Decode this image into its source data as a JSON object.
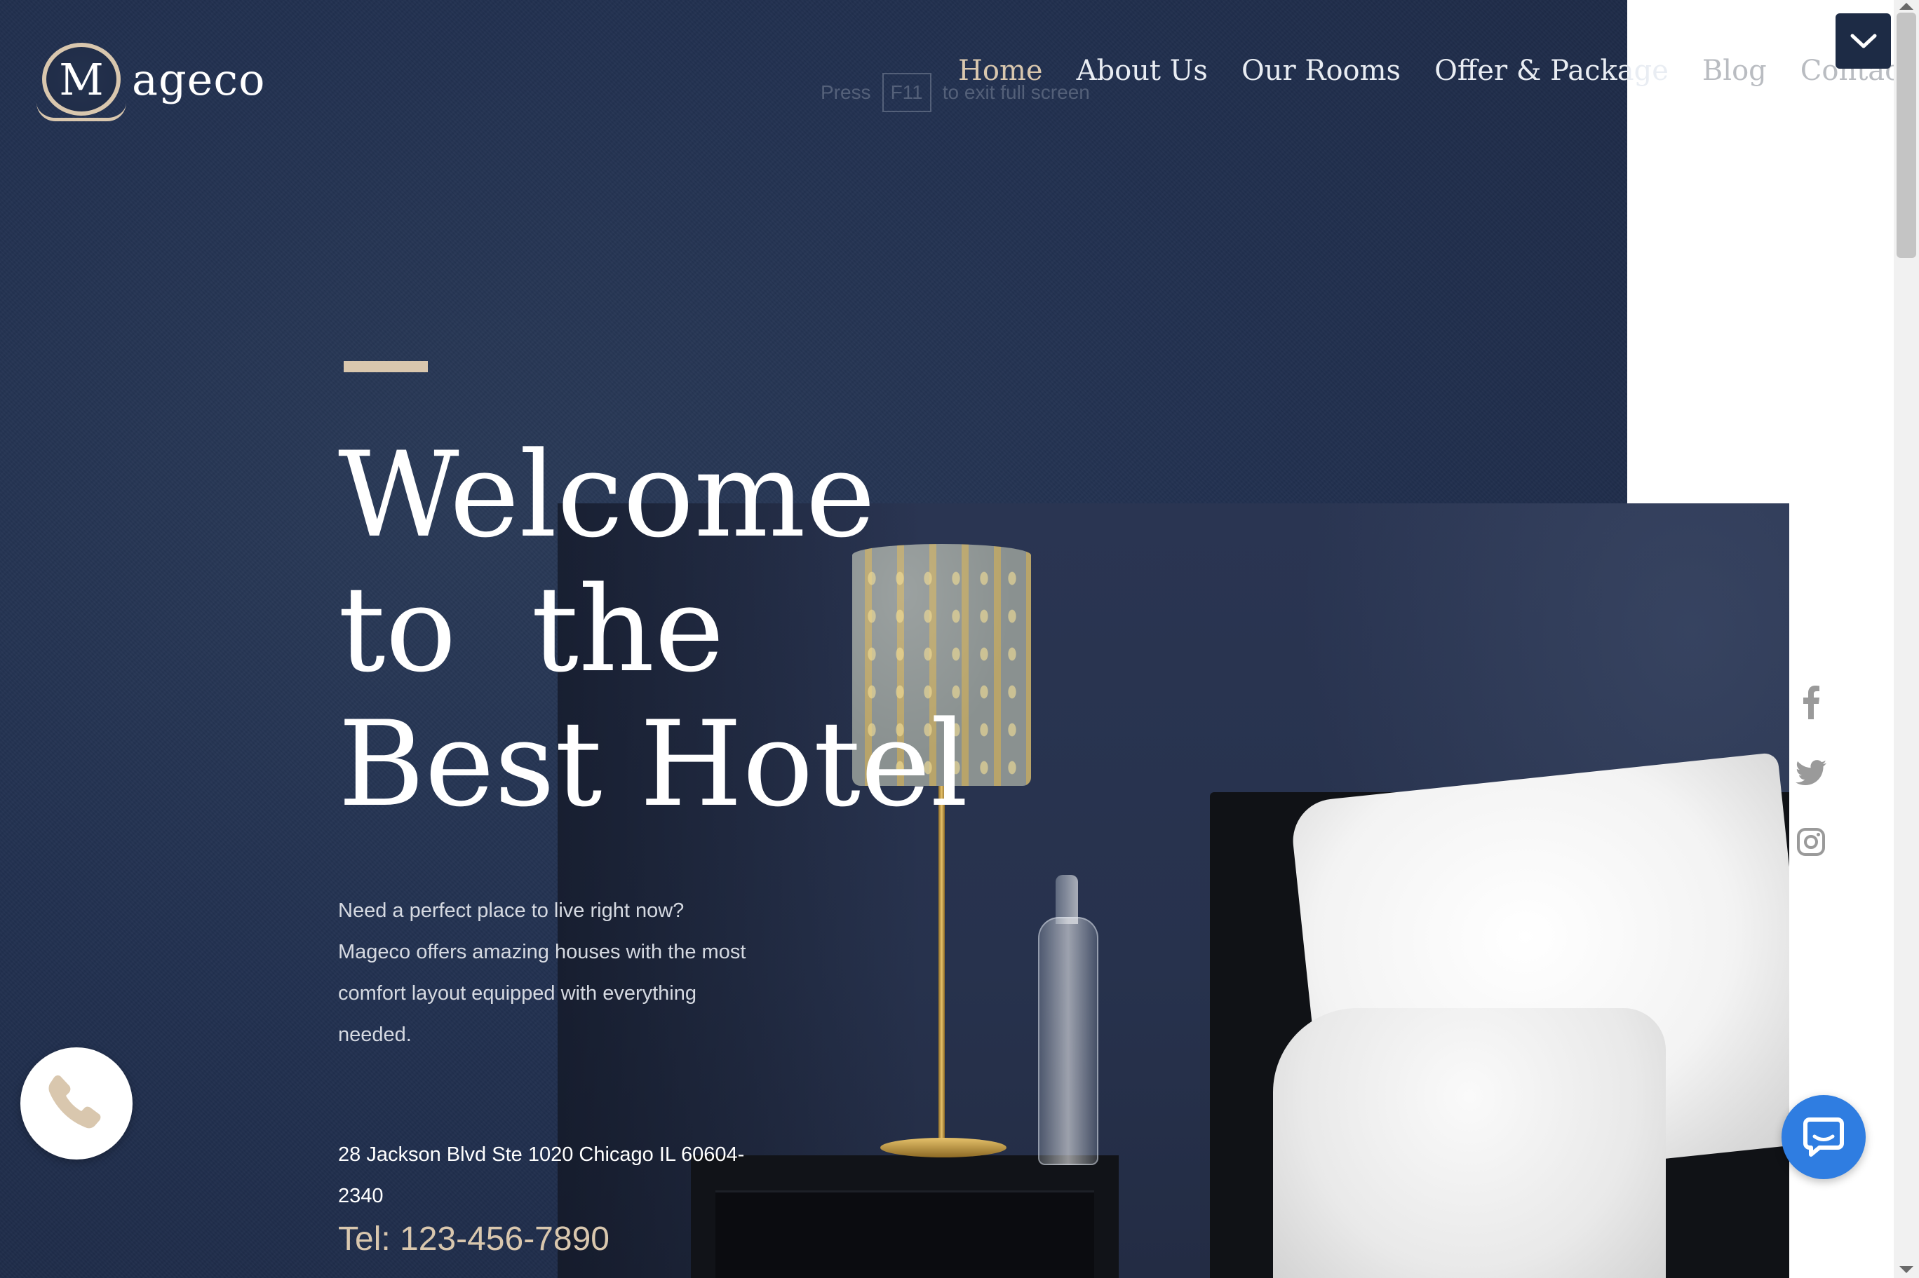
{
  "brand": {
    "logo_letter": "M",
    "name": "ageco"
  },
  "nav": {
    "items": [
      {
        "label": "Home",
        "active": true
      },
      {
        "label": "About Us"
      },
      {
        "label": "Our Rooms"
      },
      {
        "label": "Offer & Package"
      },
      {
        "label": "Blog"
      },
      {
        "label": "Contacts"
      }
    ]
  },
  "fullscreen_notice": {
    "prefix": "Press",
    "key": "F11",
    "suffix": "to exit full screen"
  },
  "hero": {
    "title_lines": [
      "Welcome",
      "to  the",
      "Best Hotel"
    ],
    "description_lines": [
      "Need a perfect place to live right now?",
      "Mageco offers amazing houses with the most",
      "comfort layout equipped with everything",
      "needed."
    ],
    "address_lines": [
      "28 Jackson Blvd Ste 1020 Chicago IL 60604-",
      "2340"
    ],
    "tel": "Tel: 123-456-7890"
  },
  "social": {
    "icons": [
      "facebook-icon",
      "twitter-icon",
      "instagram-icon"
    ]
  },
  "widgets": {
    "call_icon": "phone-icon",
    "chat_icon": "chat-bubble-icon",
    "dropdown_icon": "chevron-down-icon"
  },
  "colors": {
    "accent": "#d9c7ae",
    "background": "#223150",
    "chat": "#2f7de1"
  }
}
